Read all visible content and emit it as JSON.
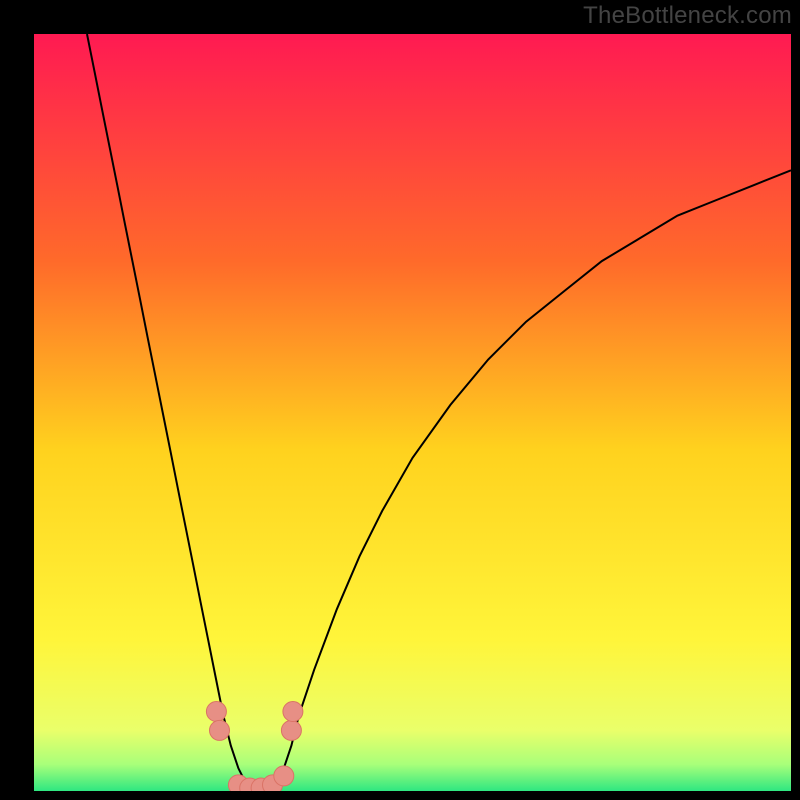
{
  "watermark": "TheBottleneck.com",
  "colors": {
    "frame": "#000000",
    "curve": "#000000",
    "marker_fill": "#e78f85",
    "marker_stroke": "#da7366",
    "grad_top": "#ff1a52",
    "grad_mid1": "#ff6a2a",
    "grad_mid2": "#ffd21e",
    "grad_mid3": "#fff53a",
    "grad_band1": "#eaff6a",
    "grad_band2": "#a8ff7a",
    "grad_bottom": "#2fe781"
  },
  "chart_data": {
    "type": "line",
    "title": "",
    "xlabel": "",
    "ylabel": "",
    "xrange": [
      0,
      100
    ],
    "yrange": [
      0,
      100
    ],
    "series": [
      {
        "name": "bottleneck-curve",
        "x": [
          7,
          8,
          9,
          10,
          11,
          12,
          13,
          14,
          15,
          16,
          17,
          18,
          19,
          20,
          21,
          22,
          23,
          24,
          25,
          26,
          27,
          28,
          29,
          30,
          31,
          32,
          33,
          34,
          35,
          37,
          40,
          43,
          46,
          50,
          55,
          60,
          65,
          70,
          75,
          80,
          85,
          90,
          95,
          100
        ],
        "y": [
          100,
          95,
          90,
          85,
          80,
          75,
          70,
          65,
          60,
          55,
          50,
          45,
          40,
          35,
          30,
          25,
          20,
          15,
          10,
          6,
          3,
          1,
          0,
          0,
          0,
          1,
          3,
          6,
          10,
          16,
          24,
          31,
          37,
          44,
          51,
          57,
          62,
          66,
          70,
          73,
          76,
          78,
          80,
          82
        ]
      }
    ],
    "markers": [
      {
        "x": 24.1,
        "y": 10.5
      },
      {
        "x": 24.5,
        "y": 8.0
      },
      {
        "x": 27.0,
        "y": 0.8
      },
      {
        "x": 28.5,
        "y": 0.4
      },
      {
        "x": 30.0,
        "y": 0.4
      },
      {
        "x": 31.5,
        "y": 0.8
      },
      {
        "x": 33.0,
        "y": 2.0
      },
      {
        "x": 34.0,
        "y": 8.0
      },
      {
        "x": 34.2,
        "y": 10.5
      }
    ],
    "green_band": {
      "y0": 0,
      "y1": 3
    },
    "light_band": {
      "y0": 3,
      "y1": 8
    }
  }
}
